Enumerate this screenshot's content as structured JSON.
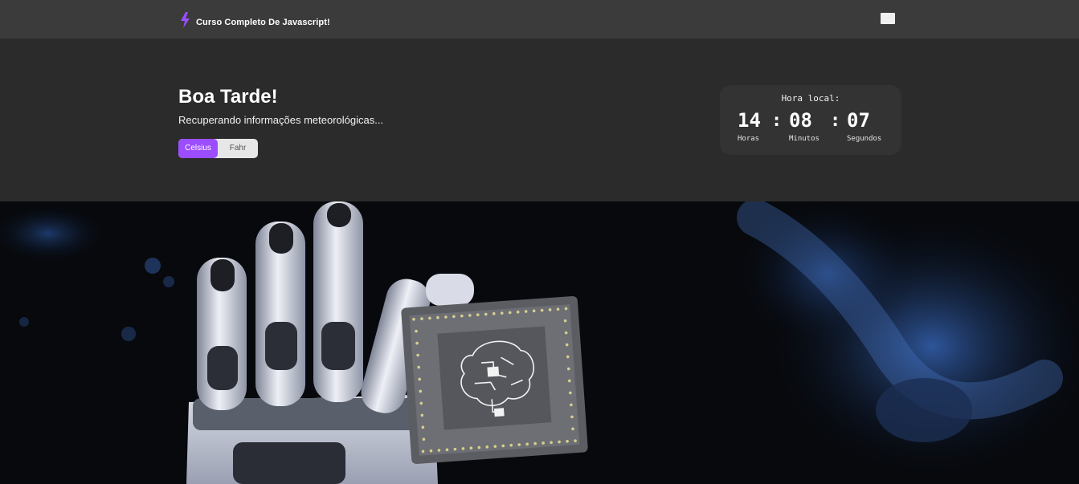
{
  "header": {
    "brand_title": "Curso Completo De Javascript!",
    "brand_icon": "lightning-bolt-icon",
    "menu_icon": "menu-icon",
    "accent_color": "#9b4dff"
  },
  "hero": {
    "greeting": "Boa Tarde!",
    "weather_status": "Recuperando informações meteorológicas...",
    "unit_toggle": {
      "celsius_label": "Celsius",
      "fahr_label": "Fahr",
      "selected": "Celsius"
    }
  },
  "clock": {
    "title": "Hora local:",
    "hours": "14",
    "minutes": "08",
    "seconds": "07",
    "separator": ":",
    "hours_label": "Horas",
    "minutes_label": "Minutos",
    "seconds_label": "Segundos"
  },
  "banner": {
    "image_subject": "robot hand holding an AI processor chip"
  }
}
